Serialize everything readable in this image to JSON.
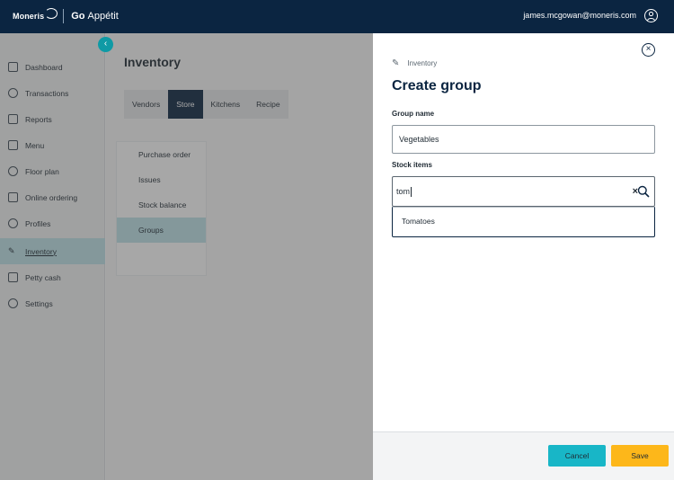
{
  "header": {
    "brand_name": "Moneris",
    "product_go": "Go",
    "product_name": "Appétit",
    "user_email": "james.mcgowan@moneris.com",
    "colors": {
      "bar": "#0b2541"
    }
  },
  "sidebar": {
    "collapse_icon": "chevron-left-icon",
    "items": [
      {
        "label": "Dashboard",
        "icon": "dashboard-icon",
        "active": false
      },
      {
        "label": "Transactions",
        "icon": "transactions-icon",
        "active": false
      },
      {
        "label": "Reports",
        "icon": "reports-icon",
        "active": false
      },
      {
        "label": "Menu",
        "icon": "menu-icon",
        "active": false
      },
      {
        "label": "Floor plan",
        "icon": "floor-plan-icon",
        "active": false
      },
      {
        "label": "Online ordering",
        "icon": "online-ordering-icon",
        "active": false
      },
      {
        "label": "Profiles",
        "icon": "profiles-icon",
        "active": false
      },
      {
        "label": "Inventory",
        "icon": "inventory-icon",
        "active": true
      },
      {
        "label": "Petty cash",
        "icon": "petty-cash-icon",
        "active": false
      },
      {
        "label": "Settings",
        "icon": "settings-icon",
        "active": false
      }
    ],
    "colors": {
      "active": "#bfe4ea"
    }
  },
  "main": {
    "title": "Inventory",
    "tabs": [
      {
        "label": "Vendors",
        "active": false
      },
      {
        "label": "Store",
        "active": true
      },
      {
        "label": "Kitchens",
        "active": false
      },
      {
        "label": "Recipe",
        "active": false
      }
    ],
    "subnav": [
      {
        "label": "Purchase order",
        "active": false
      },
      {
        "label": "Issues",
        "active": false
      },
      {
        "label": "Stock balance",
        "active": false
      },
      {
        "label": "Groups",
        "active": true
      }
    ]
  },
  "panel": {
    "breadcrumb": "Inventory",
    "breadcrumb_icon": "pencil-icon",
    "title": "Create group",
    "group_name_label": "Group name",
    "group_name_value": "Vegetables",
    "stock_items_label": "Stock items",
    "search_value": "tom",
    "clear_icon": "clear-x-icon",
    "search_icon": "search-icon",
    "suggestions": [
      "Tomatoes"
    ],
    "cancel_label": "Cancel",
    "save_label": "Save",
    "colors": {
      "cancel": "#18b6c7",
      "save": "#fdb71a",
      "accent": "#0b2541"
    }
  }
}
